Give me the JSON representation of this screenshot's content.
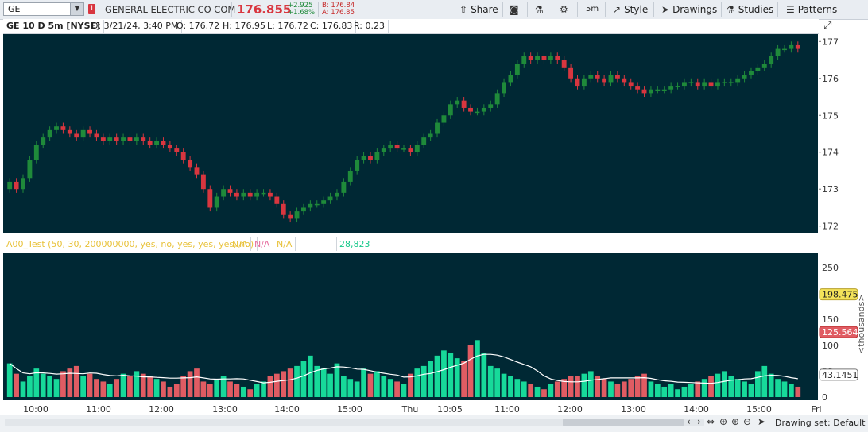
{
  "toolbar": {
    "symbol": "GE",
    "dropdown_icon": "triangle-down-icon",
    "alert_badge": "1",
    "company": "GENERAL ELECTRIC CO COM",
    "last_price": "176.855",
    "net_change": "+2.925",
    "pct_change": "+1.68%",
    "bid": "B: 176.84",
    "ask": "A: 176.85",
    "share_label": "Share",
    "timeframe_label": "5m",
    "style_label": "Style",
    "drawings_label": "Drawings",
    "studies_label": "Studies",
    "patterns_label": "Patterns",
    "colors": {
      "up": "#1f8a3a",
      "down": "#d8363f"
    }
  },
  "header": {
    "title": "GE 10 D 5m [NYSE]",
    "date": "D: 3/21/24, 3:40 PM",
    "open": "O: 176.72",
    "high": "H: 176.95",
    "low": "L: 176.72",
    "close": "C: 176.83",
    "range": "R: 0.23"
  },
  "study_header": {
    "name": "A00_Test (50, 30, 200000000, yes, no, yes, yes, yes, no)",
    "v1": "N/A",
    "v2": "N/A",
    "v3": "N/A",
    "v4": "",
    "v5": "28,823"
  },
  "price_axis": {
    "ticks": [
      "177",
      "176",
      "175",
      "174",
      "173",
      "172"
    ]
  },
  "volume_axis": {
    "ticks": [
      "250",
      "150",
      "100",
      "50",
      "0"
    ],
    "unit_label": "<thousands>",
    "tags": [
      "198.475",
      "125.564",
      "43.1451"
    ]
  },
  "time_axis": {
    "ticks": [
      "10:00",
      "11:00",
      "12:00",
      "13:00",
      "14:00",
      "15:00",
      "Thu",
      "10:05",
      "11:00",
      "12:00",
      "13:00",
      "14:00",
      "15:00",
      "Fri"
    ]
  },
  "bottom_bar": {
    "drawing_set": "Drawing set: Default"
  },
  "chart_data": [
    {
      "type": "candlestick",
      "ylim": [
        171.8,
        177.2
      ],
      "colors": {
        "up": "#1f8a3a",
        "down": "#d8363f",
        "background": "#002834"
      },
      "close": [
        173.2,
        173.0,
        173.3,
        173.8,
        174.2,
        174.4,
        174.6,
        174.7,
        174.6,
        174.5,
        174.4,
        174.6,
        174.5,
        174.4,
        174.3,
        174.4,
        174.3,
        174.4,
        174.3,
        174.4,
        174.3,
        174.2,
        174.3,
        174.2,
        174.1,
        174.0,
        173.8,
        173.6,
        173.4,
        173.0,
        172.5,
        172.8,
        173.0,
        172.9,
        172.8,
        172.9,
        172.8,
        172.9,
        172.9,
        172.8,
        172.6,
        172.3,
        172.2,
        172.4,
        172.5,
        172.6,
        172.6,
        172.7,
        172.8,
        172.9,
        173.2,
        173.5,
        173.8,
        173.9,
        173.8,
        174.0,
        174.1,
        174.2,
        174.1,
        174.1,
        174.0,
        174.2,
        174.4,
        174.5,
        174.8,
        175.0,
        175.3,
        175.4,
        175.2,
        175.1,
        175.1,
        175.2,
        175.3,
        175.6,
        175.9,
        176.1,
        176.4,
        176.6,
        176.5,
        176.6,
        176.5,
        176.6,
        176.5,
        176.3,
        176.0,
        175.8,
        176.0,
        176.1,
        176.0,
        175.9,
        176.1,
        176.0,
        175.9,
        175.8,
        175.7,
        175.6,
        175.7,
        175.7,
        175.7,
        175.8,
        175.8,
        175.9,
        175.9,
        175.8,
        175.9,
        175.8,
        175.9,
        175.9,
        175.9,
        176.0,
        176.1,
        176.2,
        176.3,
        176.4,
        176.6,
        176.8,
        176.8,
        176.9,
        176.8
      ]
    },
    {
      "type": "bar",
      "ylim": [
        0,
        270
      ],
      "colors": {
        "up": "#17d99a",
        "down": "#e05c63",
        "avg_line": "#ffffff"
      },
      "values": [
        65,
        45,
        30,
        40,
        55,
        45,
        40,
        35,
        50,
        55,
        60,
        40,
        45,
        35,
        30,
        25,
        35,
        45,
        40,
        50,
        45,
        40,
        35,
        30,
        20,
        25,
        40,
        50,
        55,
        30,
        25,
        35,
        40,
        30,
        25,
        20,
        15,
        25,
        30,
        40,
        45,
        50,
        55,
        60,
        70,
        80,
        60,
        55,
        45,
        65,
        40,
        35,
        30,
        55,
        45,
        50,
        40,
        35,
        30,
        25,
        45,
        55,
        60,
        70,
        80,
        90,
        85,
        75,
        70,
        100,
        110,
        85,
        60,
        55,
        45,
        40,
        35,
        30,
        25,
        20,
        15,
        25,
        30,
        35,
        40,
        40,
        45,
        50,
        40,
        35,
        30,
        25,
        30,
        35,
        40,
        45,
        30,
        25,
        20,
        25,
        15,
        20,
        25,
        30,
        35,
        40,
        45,
        50,
        40,
        35,
        30,
        25,
        50,
        60,
        45,
        35,
        30,
        25,
        20
      ]
    }
  ]
}
